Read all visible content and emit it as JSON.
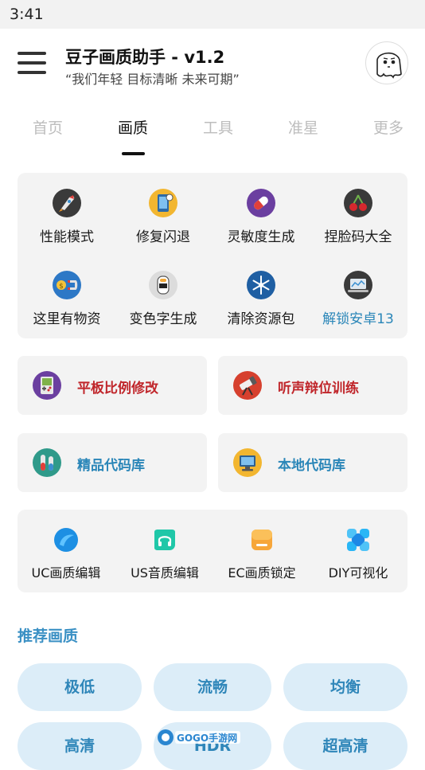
{
  "status_bar": {
    "time": "3:41"
  },
  "header": {
    "title": "豆子画质助手 - v1.2",
    "subtitle": "“我们年轻 目标清晰 未来可期”"
  },
  "tabs": [
    {
      "label": "首页",
      "active": false
    },
    {
      "label": "画质",
      "active": true
    },
    {
      "label": "工具",
      "active": false
    },
    {
      "label": "准星",
      "active": false
    },
    {
      "label": "更多",
      "active": false
    }
  ],
  "features": [
    {
      "label": "性能模式",
      "icon": "rocket-icon"
    },
    {
      "label": "修复闪退",
      "icon": "phone-repair-icon"
    },
    {
      "label": "灵敏度生成",
      "icon": "pill-icon"
    },
    {
      "label": "捏脸码大全",
      "icon": "cherry-icon"
    },
    {
      "label": "这里有物资",
      "icon": "money-magnet-icon"
    },
    {
      "label": "变色字生成",
      "icon": "color-text-icon"
    },
    {
      "label": "清除资源包",
      "icon": "snowflake-icon"
    },
    {
      "label": "解锁安卓13",
      "icon": "laptop-icon"
    }
  ],
  "cards": {
    "tablet_ratio": {
      "label": "平板比例修改",
      "icon": "gameboy-icon"
    },
    "sound_training": {
      "label": "听声辩位训练",
      "icon": "telescope-icon"
    },
    "premium_codes": {
      "label": "精品代码库",
      "icon": "test-tube-icon"
    },
    "local_codes": {
      "label": "本地代码库",
      "icon": "computer-icon"
    }
  },
  "tools": [
    {
      "label": "UC画质编辑",
      "icon": "uc-icon"
    },
    {
      "label": "US音质编辑",
      "icon": "headphones-icon"
    },
    {
      "label": "EC画质锁定",
      "icon": "ec-icon"
    },
    {
      "label": "DIY可视化",
      "icon": "diy-icon"
    }
  ],
  "recommended": {
    "title": "推荐画质",
    "options": [
      "极低",
      "流畅",
      "均衡",
      "高清",
      "HDR",
      "超高清"
    ]
  },
  "watermark": {
    "brand": "GOGO手游网"
  },
  "colors": {
    "accent_blue": "#3a90c4",
    "accent_red": "#c0262b",
    "pill_bg": "#dcedf8",
    "panel_bg": "#f3f3f3"
  }
}
